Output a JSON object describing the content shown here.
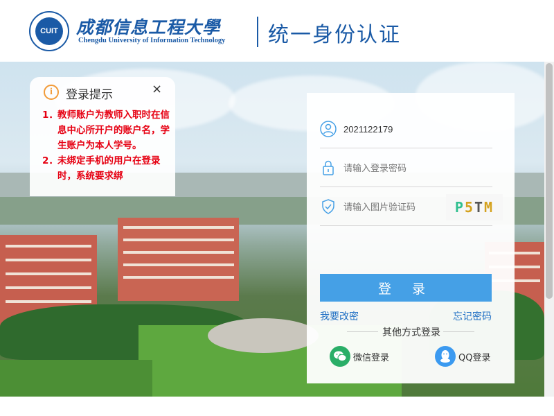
{
  "header": {
    "seal_text": "CUIT",
    "school_name_cn": "成都信息工程大學",
    "school_name_en": "Chengdu University of Information Technology",
    "system_title": "统一身份认证"
  },
  "notice": {
    "title": "登录提示",
    "close": "×",
    "info_glyph": "i",
    "items": [
      {
        "num": "1．",
        "text": "教师账户为教师入职时在信息中心所开户的账户名，学生账户为本人学号。"
      },
      {
        "num": "2．",
        "text": "未绑定手机的用户在登录时，系统要求绑"
      }
    ]
  },
  "login": {
    "username_value": "2021122179",
    "password_placeholder": "请输入登录密码",
    "captcha_placeholder": "请输入图片验证码",
    "captcha_chars": [
      "P",
      "5",
      "T",
      "M"
    ],
    "captcha_colors": [
      "#2fbf8f",
      "#d4a11d",
      "#555555",
      "#d4a11d"
    ],
    "submit_label": "登 录",
    "change_password": "我要改密",
    "forgot_password": "忘记密码",
    "other_methods": "其他方式登录",
    "wechat_label": "微信登录",
    "qq_label": "QQ登录"
  },
  "colors": {
    "brand": "#1a5aa6",
    "button": "#45a0e6",
    "notice_text": "#e60012",
    "wechat": "#2aae67",
    "qq": "#3b9af0"
  },
  "icons": {
    "user": "user-icon",
    "lock": "lock-icon",
    "shield": "shield-check-icon",
    "wechat": "wechat-icon",
    "qq": "qq-icon"
  }
}
